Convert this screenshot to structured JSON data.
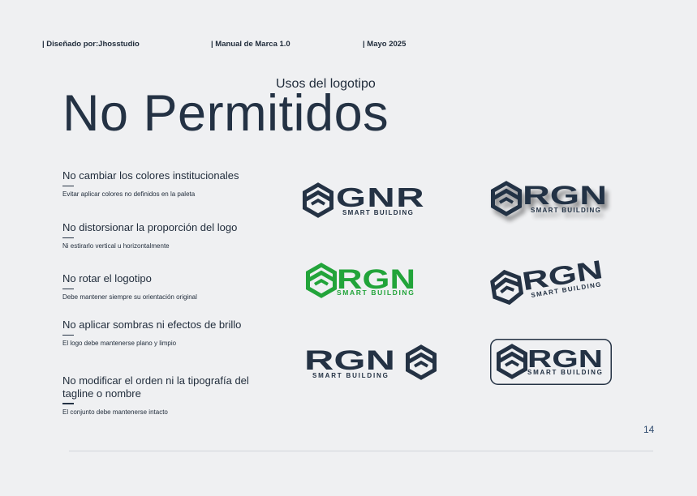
{
  "header": {
    "designer": "| Diseñado por:Jhosstudio",
    "manual": "| Manual de Marca 1.0",
    "date": "| Mayo 2025"
  },
  "page": {
    "subtitle": "Usos del logotipo",
    "title": "No Permitidos",
    "page_number": "14"
  },
  "rules": [
    {
      "heading": "No cambiar los colores institucionales",
      "note": "Evitar aplicar colores no definidos en la paleta"
    },
    {
      "heading": "No distorsionar la proporción del logo",
      "note": "Ni estirarlo vertical u horizontalmente"
    },
    {
      "heading": "No rotar el logotipo",
      "note": "Debe mantener siempre su orientación original"
    },
    {
      "heading": "No aplicar sombras ni efectos de brillo",
      "note": "El logo debe mantenerse plano y limpio"
    },
    {
      "heading": "No modificar el orden ni la tipografía del tagline o nombre",
      "note": "El conjunto debe mantenerse intacto"
    }
  ],
  "logos": {
    "wrong_name": "GNR",
    "brand": "RGN",
    "tagline": "SMART BUILDING"
  },
  "colors": {
    "navy": "#243244",
    "green": "#22a43a",
    "background": "#eff0f2"
  }
}
